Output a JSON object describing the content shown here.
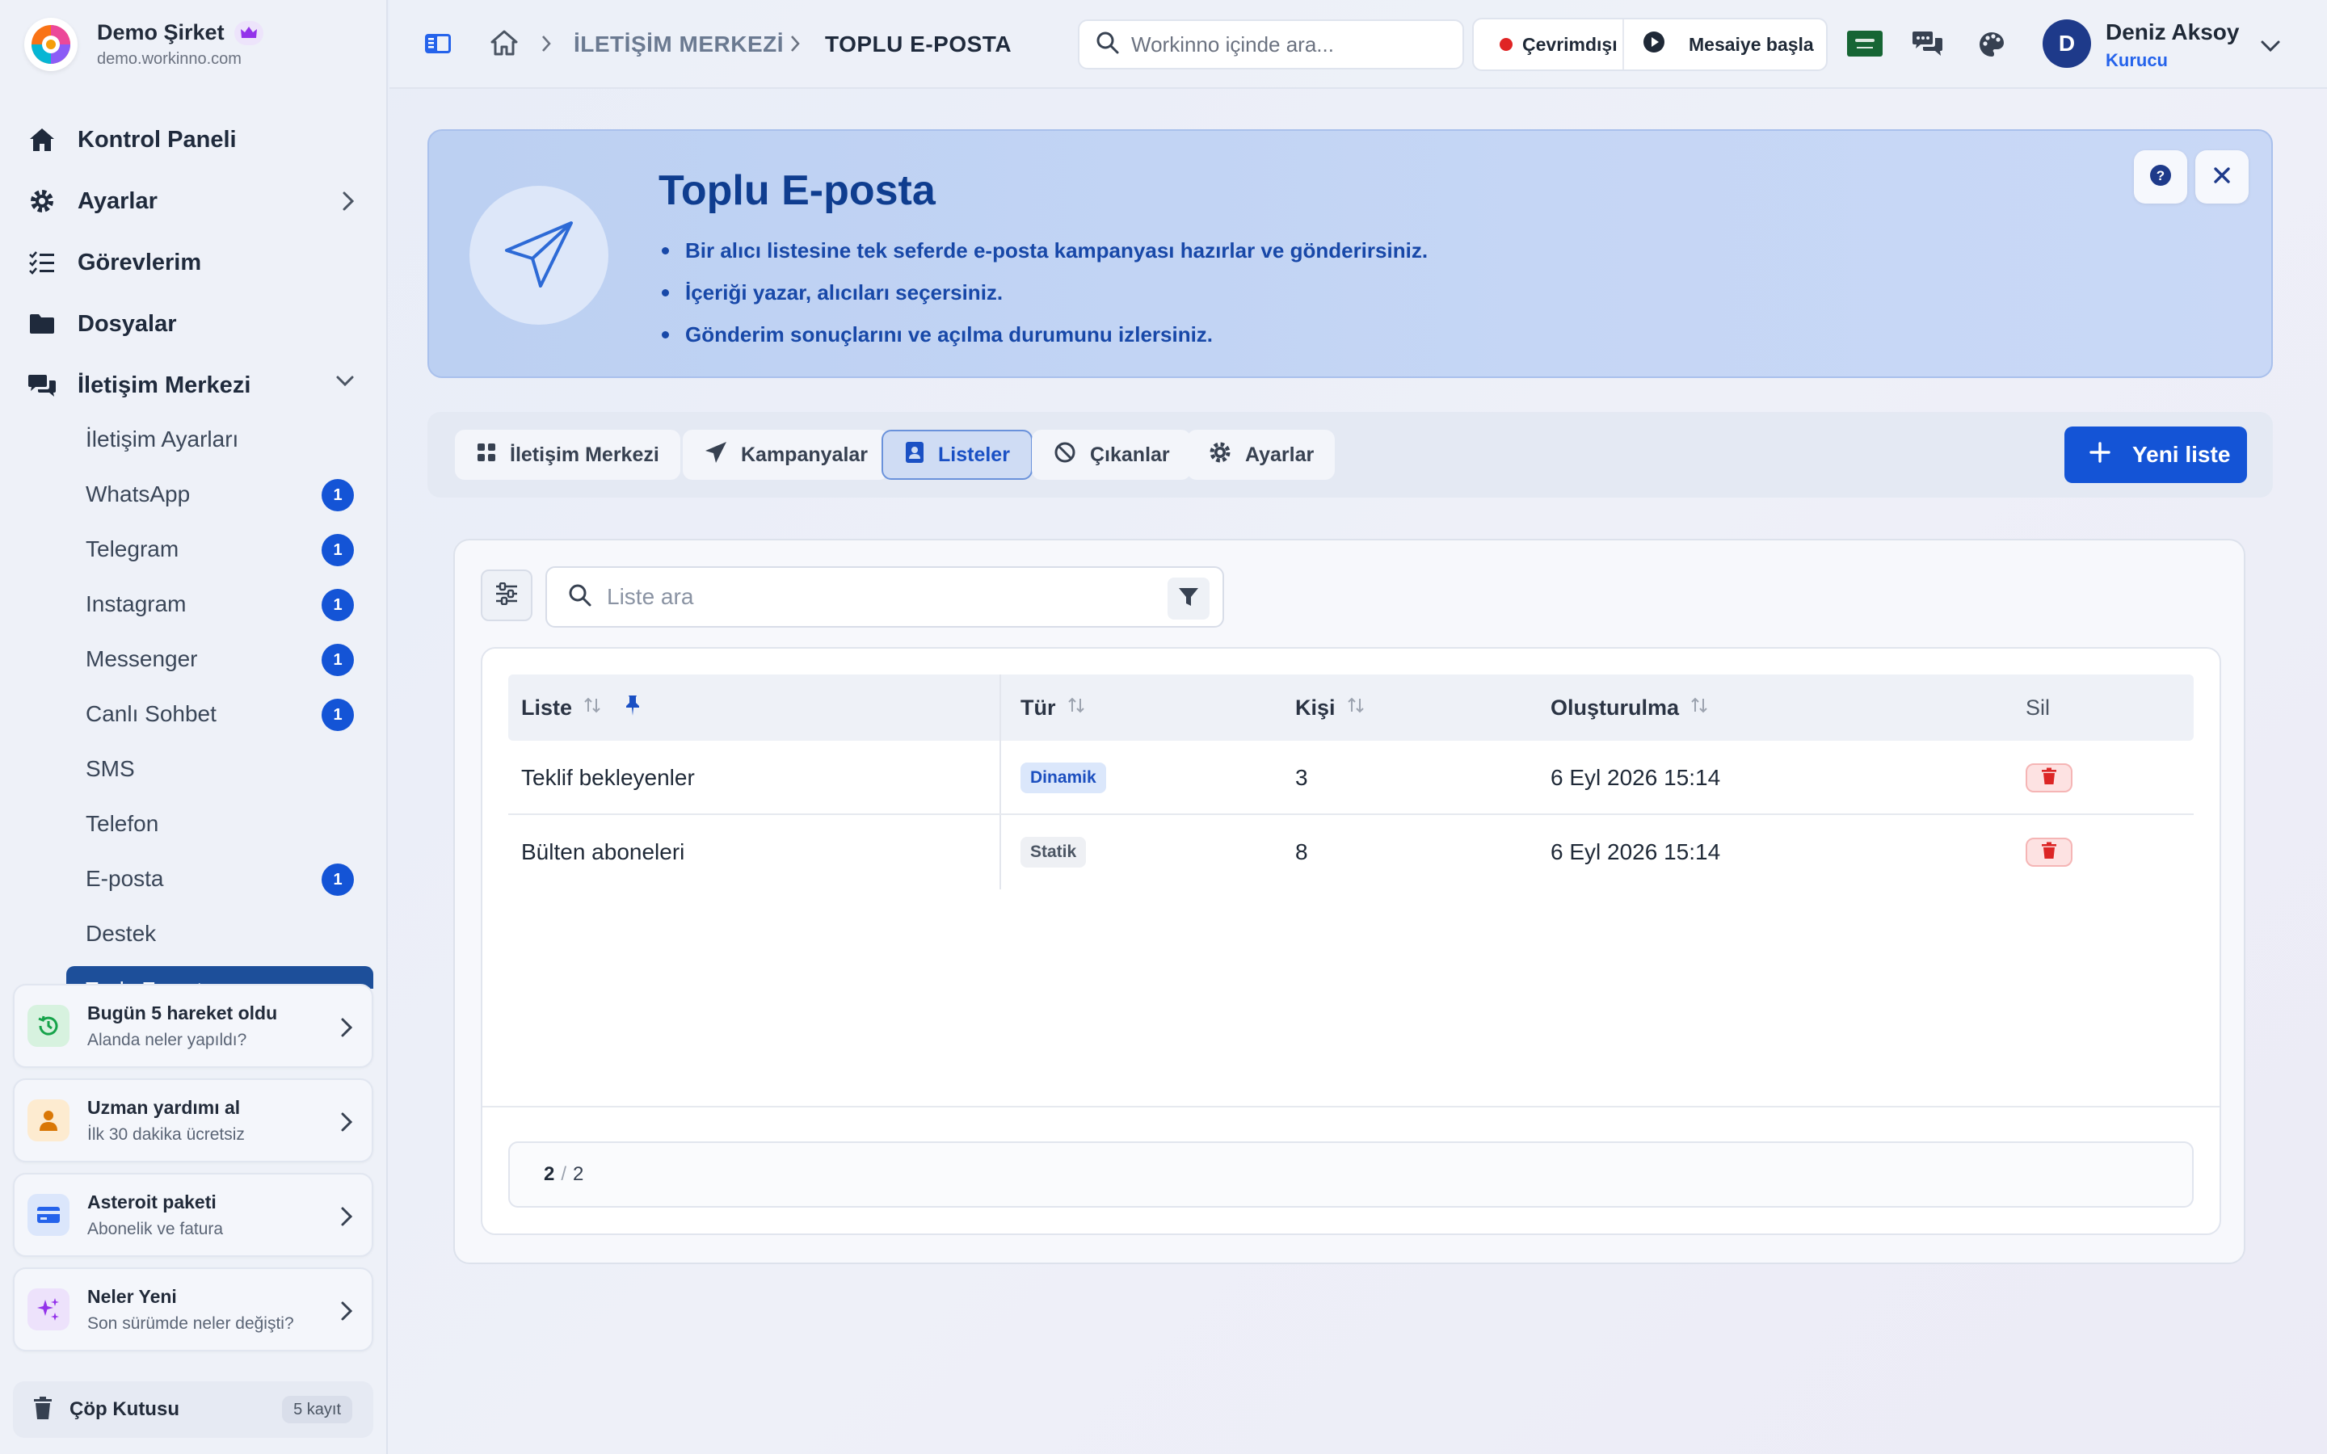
{
  "brand": {
    "name": "Demo Şirket",
    "url": "demo.workinno.com"
  },
  "nav": {
    "dashboard": "Kontrol Paneli",
    "settings": "Ayarlar",
    "tasks": "Görevlerim",
    "files": "Dosyalar",
    "comm_center": "İletişim Merkezi"
  },
  "subnav": [
    {
      "label": "İletişim Ayarları",
      "badge": null
    },
    {
      "label": "WhatsApp",
      "badge": "1"
    },
    {
      "label": "Telegram",
      "badge": "1"
    },
    {
      "label": "Instagram",
      "badge": "1"
    },
    {
      "label": "Messenger",
      "badge": "1"
    },
    {
      "label": "Canlı Sohbet",
      "badge": "1"
    },
    {
      "label": "SMS",
      "badge": null
    },
    {
      "label": "Telefon",
      "badge": null
    },
    {
      "label": "E-posta",
      "badge": "1"
    },
    {
      "label": "Destek",
      "badge": null
    },
    {
      "label": "Toplu E-posta",
      "badge": null,
      "active": true
    }
  ],
  "cards": [
    {
      "title": "Bugün 5 hareket oldu",
      "sub": "Alanda neler yapıldı?",
      "icon": "history-icon",
      "color": "#16a34a"
    },
    {
      "title": "Uzman yardımı al",
      "sub": "İlk 30 dakika ücretsiz",
      "icon": "person-icon",
      "color": "#d97706"
    },
    {
      "title": "Asteroit paketi",
      "sub": "Abonelik ve fatura",
      "icon": "credit-card-icon",
      "color": "#2563eb"
    },
    {
      "title": "Neler Yeni",
      "sub": "Son sürümde neler değişti?",
      "icon": "sparkle-icon",
      "color": "#9333ea"
    }
  ],
  "trash": {
    "label": "Çöp Kutusu",
    "count": "5 kayıt"
  },
  "topbar": {
    "breadcrumb": [
      "İLETİŞİM MERKEZİ",
      "TOPLU E-POSTA"
    ],
    "search_placeholder": "Workinno içinde ara...",
    "status": "Çevrimdışı",
    "shift": "Mesaiye başla",
    "user": {
      "initial": "D",
      "name": "Deniz Aksoy",
      "role": "Kurucu"
    }
  },
  "hero": {
    "title": "Toplu E-posta",
    "bullets": [
      "Bir alıcı listesine tek seferde e-posta kampanyası hazırlar ve gönderirsiniz.",
      "İçeriği yazar, alıcıları seçersiniz.",
      "Gönderim sonuçlarını ve açılma durumunu izlersiniz."
    ]
  },
  "tabs": [
    {
      "label": "İletişim Merkezi",
      "icon": "grid-icon"
    },
    {
      "label": "Kampanyalar",
      "icon": "send-icon"
    },
    {
      "label": "Listeler",
      "icon": "contacts-icon",
      "active": true
    },
    {
      "label": "Çıkanlar",
      "icon": "ban-icon"
    },
    {
      "label": "Ayarlar",
      "icon": "gear-icon"
    }
  ],
  "new_button": "Yeni liste",
  "list_search_placeholder": "Liste ara",
  "table": {
    "columns": [
      "Liste",
      "Tür",
      "Kişi",
      "Oluşturulma",
      "Sil"
    ],
    "rows": [
      {
        "name": "Teklif bekleyenler",
        "type": "Dinamik",
        "count": "3",
        "created": "6 Eyl 2026 15:14"
      },
      {
        "name": "Bülten aboneleri",
        "type": "Statik",
        "count": "8",
        "created": "6 Eyl 2026 15:14"
      }
    ]
  },
  "pager": {
    "current": "2",
    "total": "2"
  },
  "colors": {
    "primary": "#1454d6",
    "hero_title": "#0f3d8f",
    "danger": "#e02424"
  }
}
